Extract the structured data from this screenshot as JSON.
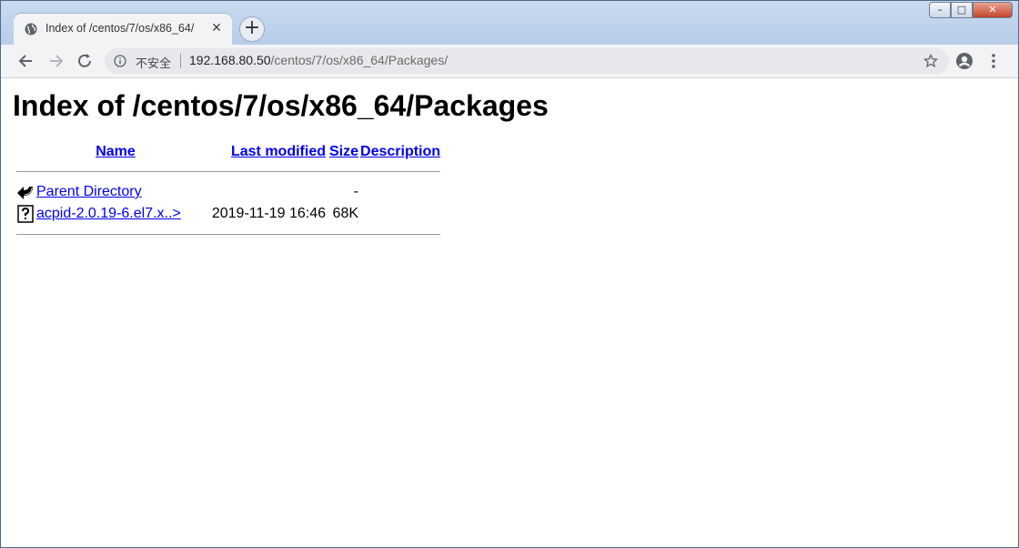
{
  "tab": {
    "title": "Index of /centos/7/os/x86_64/"
  },
  "newtab_label": "+",
  "window": {
    "min": "–",
    "max": "□",
    "close": "✕"
  },
  "omnibox": {
    "security": "不安全",
    "host": "192.168.80.50",
    "path": "/centos/7/os/x86_64/Packages/"
  },
  "page": {
    "title": "Index of /centos/7/os/x86_64/Packages",
    "headers": {
      "name": "Name",
      "modified": "Last modified",
      "size": "Size",
      "description": "Description"
    },
    "rows": [
      {
        "icon": "back-icon",
        "name": "Parent Directory",
        "modified": "",
        "size": "-",
        "description": ""
      },
      {
        "icon": "unknown-file-icon",
        "name": "acpid-2.0.19-6.el7.x..>",
        "modified": "2019-11-19 16:46",
        "size": "68K",
        "description": ""
      }
    ]
  },
  "colors": {
    "link": "#0000ee",
    "tabstrip": "#c9daf0"
  }
}
